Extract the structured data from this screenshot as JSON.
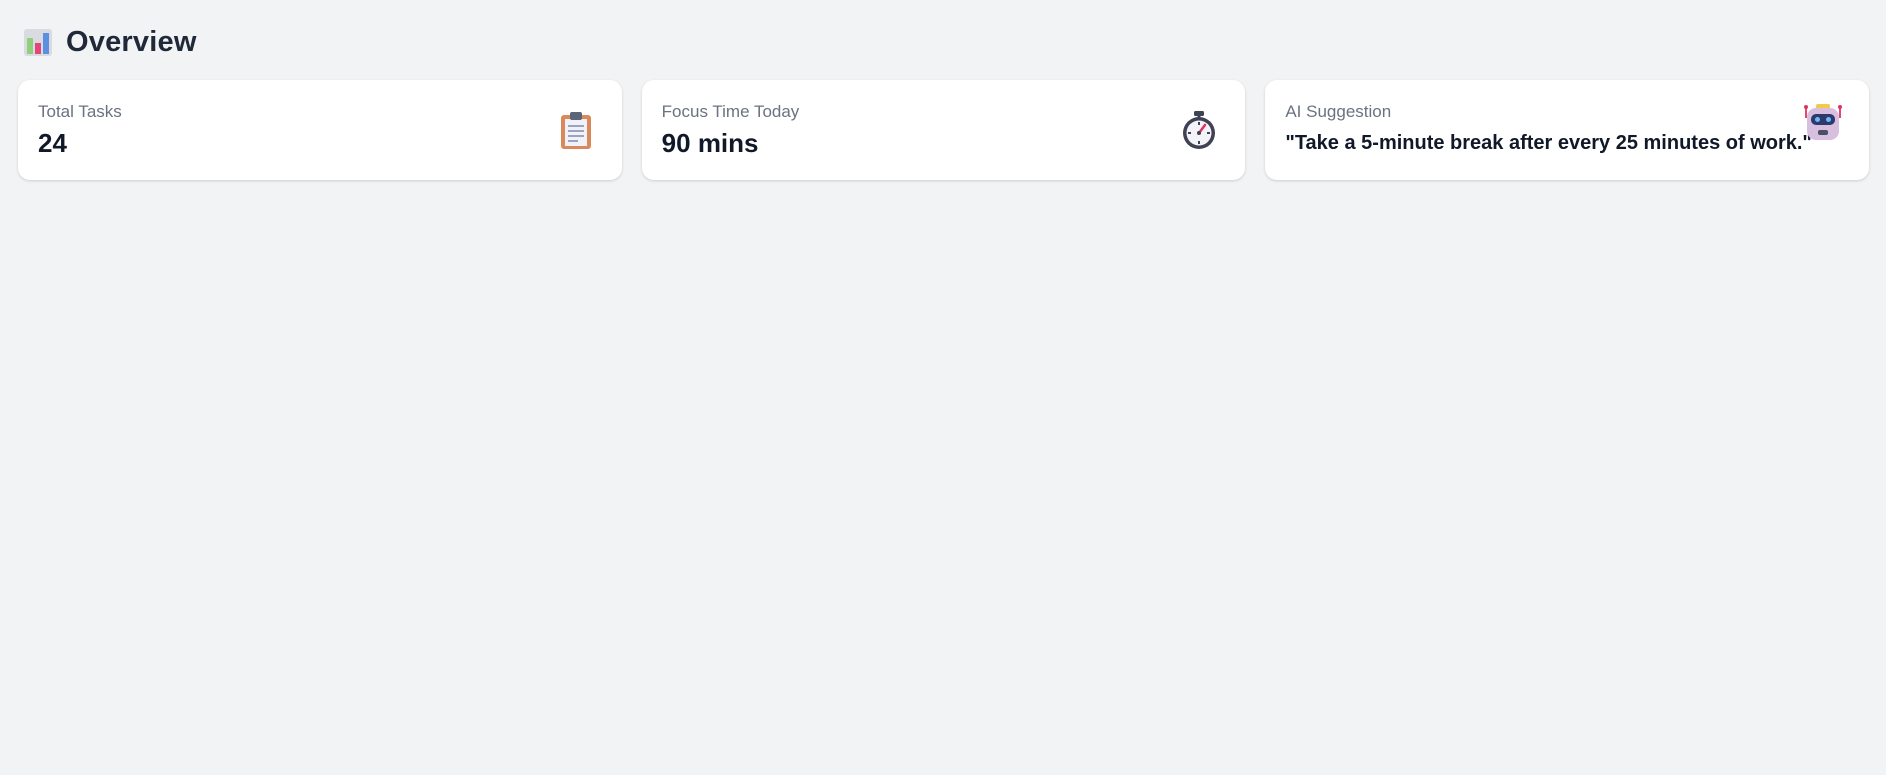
{
  "header": {
    "title": "Overview",
    "icon": "bar-chart-icon"
  },
  "cards": [
    {
      "label": "Total Tasks",
      "value": "24",
      "icon": "clipboard-icon"
    },
    {
      "label": "Focus Time Today",
      "value": "90 mins",
      "icon": "stopwatch-icon"
    },
    {
      "label": "AI Suggestion",
      "value": "\"Take a 5-minute break after every 25 minutes of work.\"",
      "icon": "robot-icon"
    }
  ],
  "colors": {
    "background": "#f2f3f5",
    "card": "#ffffff",
    "label": "#6b7280",
    "value": "#111827"
  }
}
